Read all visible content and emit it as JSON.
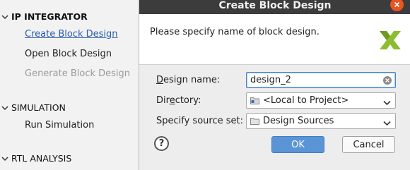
{
  "flow_navigator": {
    "sections": [
      {
        "label": "IP INTEGRATOR",
        "items": [
          {
            "label": "Create Block Design"
          },
          {
            "label": "Open Block Design"
          },
          {
            "label": "Generate Block Design"
          }
        ]
      },
      {
        "label": "SIMULATION",
        "items": [
          {
            "label": "Run Simulation"
          }
        ]
      },
      {
        "label": "RTL ANALYSIS",
        "items": []
      }
    ]
  },
  "dialog": {
    "title": "Create Block Design",
    "message": "Please specify name of block design.",
    "design_name": {
      "label_first": "D",
      "label_rest": "esign name:",
      "value": "design_2"
    },
    "directory": {
      "label_first": "Dir",
      "label_mid": "e",
      "label_rest": "ctory:",
      "value": "<Local to Project>"
    },
    "source_set": {
      "label": "Specify source set:",
      "value": "Design Sources"
    },
    "help_label": "?",
    "ok_label": "OK",
    "cancel_label": "Cancel"
  },
  "colors": {
    "titlebar": "#3c3c3c",
    "close_button": "#e95420",
    "link": "#2a5db0",
    "ok_button": "#5a94d6",
    "logo": "#8bbd2e"
  }
}
